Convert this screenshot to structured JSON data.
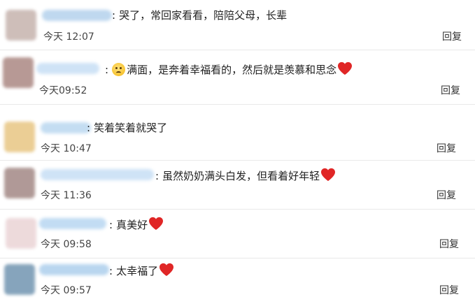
{
  "comments": [
    {
      "text": "哭了，常回家看看，陪陪父母，长辈",
      "time": "今天 12:07",
      "reply": "回复",
      "heart": false,
      "emoji": false,
      "avatar_color": "#c9b7b2",
      "name_color": "#bfd8ef"
    },
    {
      "text": "满面，是奔着幸福看的，然后就是羡慕和思念",
      "time": "今天09:52",
      "reply": "回复",
      "heart": true,
      "emoji": true,
      "avatar_color": "#b08f8a",
      "name_color": "#cfe3f6"
    },
    {
      "text": "笑着笑着就哭了",
      "time": "今天 10:47",
      "reply": "回复",
      "heart": false,
      "emoji": false,
      "avatar_color": "#e9c98a",
      "name_color": "#c4ddf2"
    },
    {
      "text": "虽然奶奶满头白发，但看着好年轻",
      "time": "今天 11:36",
      "reply": "回复",
      "heart": true,
      "emoji": false,
      "avatar_color": "#a88f8c",
      "name_color": "#cfe3f6"
    },
    {
      "text": "真美好",
      "time": "今天 09:58",
      "reply": "回复",
      "heart": true,
      "emoji": false,
      "avatar_color": "#ecd6d8",
      "name_color": "#c2dcf3"
    },
    {
      "text": "太幸福了",
      "time": "今天 09:57",
      "reply": "回复",
      "heart": true,
      "emoji": false,
      "avatar_color": "#7a9bb5",
      "name_color": "#b9d6ef"
    }
  ],
  "colors": {
    "heart": "#e02626",
    "separator": "#e9e9e9"
  },
  "icons": {
    "heart": "heart-icon",
    "emoji": "teary-face-icon"
  }
}
